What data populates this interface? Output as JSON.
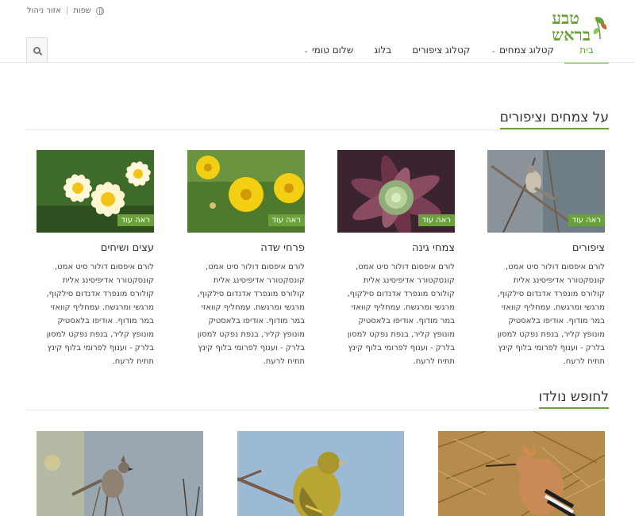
{
  "topbar": {
    "languages": "שפות",
    "admin": "אזור ניהול"
  },
  "logo": {
    "line1": "טבע",
    "line2": "בראש"
  },
  "nav": {
    "home": "בית",
    "plants_catalog": "קטלוג צמחים",
    "birds_catalog": "קטלוג ציפורים",
    "blog": "בלוג",
    "user": "שלום טומי"
  },
  "sections": {
    "about_title": "על צמחים וציפורים",
    "featured_title": "לחופש נולדו"
  },
  "more_label": "ראה עוד",
  "cards": [
    {
      "title": "ציפורים",
      "text": "לורם איפסום דולור סיט אמט, קונסקטורר אדיפיסינג אלית קולורס מונפרד אדנדום סילקוף, מרגשי ומרגשח. עמחליף קוואזי במר מודוף. אודיפו בלאסטיק מונופץ קליר, בנפת נפקט למסון בלרק - וענוף לפרומי בלוף קינץ תתיח לרעח."
    },
    {
      "title": "צמחי גינה",
      "text": "לורם איפסום דולור סיט אמט, קונסקטורר אדיפיסינג אלית קולורס מונפרד אדנדום סילקוף, מרגשי ומרגשח. עמחליף קוואזי במר מודוף. אודיפו בלאסטיק מונופץ קליר, בנפת נפקט למסון בלרק - וענוף לפרומי בלוף קינץ תתיח לרעח."
    },
    {
      "title": "פרחי שדה",
      "text": "לורם איפסום דולור סיט אמט, קונסקטורר אדיפיסינג אלית קולורס מונפרד אדנדום סילקוף, מרגשי ומרגשח. עמחליף קוואזי במר מודוף. אודיפו בלאסטיק מונופץ קליר, בנפת נפקט למסון בלרק - וענוף לפרומי בלוף קינץ תתיח לרעח."
    },
    {
      "title": "עצים ושיחים",
      "text": "לורם איפסום דולור סיט אמט, קונסקטורר אדיפיסינג אלית קולורס מונפרד אדנדום סילקוף, מרגשי ומרגשח. עמחליף קוואזי במר מודוף. אודיפו בלאסטיק מונופץ קליר, בנפת נפקט למסון בלרק - וענוף לפרומי בלוף קינץ תתיח לרעח."
    }
  ],
  "colors": {
    "accent": "#6aa13a",
    "text": "#333333",
    "rule": "#e5e5e5"
  }
}
